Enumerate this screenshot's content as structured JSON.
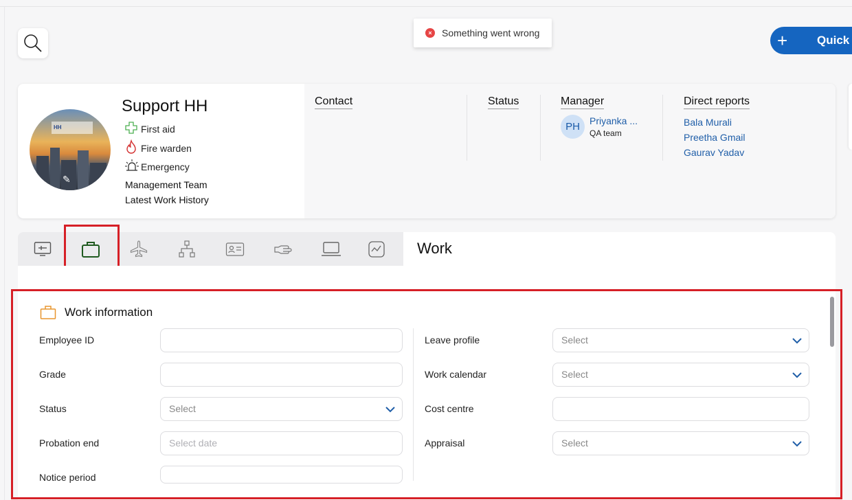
{
  "toast": {
    "message": "Something went wrong"
  },
  "quick_button": {
    "label": "Quick"
  },
  "profile": {
    "name": "Support HH",
    "badges": [
      {
        "label": "First aid",
        "icon": "first-aid-cross-icon"
      },
      {
        "label": "Fire warden",
        "icon": "flame-icon"
      },
      {
        "label": "Emergency",
        "icon": "siren-icon"
      }
    ],
    "links": [
      "Management Team",
      "Latest Work History"
    ],
    "columns": {
      "contact": "Contact",
      "status": "Status",
      "manager": "Manager",
      "direct_reports": "Direct reports"
    },
    "manager": {
      "initials": "PH",
      "name": "Priyanka ...",
      "team": "QA team"
    },
    "direct_reports": [
      "Bala Murali",
      "Preetha Gmail",
      "Gaurav Yadav"
    ]
  },
  "tabs": [
    {
      "name": "tab-dashboard",
      "icon": "monitor-icon"
    },
    {
      "name": "tab-work",
      "icon": "briefcase-icon",
      "selected": true
    },
    {
      "name": "tab-travel",
      "icon": "airplane-icon"
    },
    {
      "name": "tab-org-chart",
      "icon": "org-chart-icon"
    },
    {
      "name": "tab-id-card",
      "icon": "id-card-icon"
    },
    {
      "name": "tab-benefits",
      "icon": "hand-icon"
    },
    {
      "name": "tab-devices",
      "icon": "laptop-icon"
    },
    {
      "name": "tab-performance",
      "icon": "chart-icon"
    }
  ],
  "content": {
    "title": "Work",
    "section_title": "Work information",
    "left_fields": [
      {
        "label": "Employee ID",
        "value": "",
        "type": "text"
      },
      {
        "label": "Grade",
        "value": "",
        "type": "text"
      },
      {
        "label": "Status",
        "value": "Select",
        "type": "select"
      },
      {
        "label": "Probation end",
        "value": "Select date",
        "type": "date"
      },
      {
        "label": "Notice period",
        "value": "",
        "type": "text"
      }
    ],
    "right_fields": [
      {
        "label": "Leave profile",
        "value": "Select",
        "type": "select"
      },
      {
        "label": "Work calendar",
        "value": "Select",
        "type": "select"
      },
      {
        "label": "Cost centre",
        "value": "",
        "type": "text"
      },
      {
        "label": "Appraisal",
        "value": "Select",
        "type": "select"
      }
    ]
  },
  "colors": {
    "accent": "#1565c0",
    "highlight": "#d61f26",
    "link": "#1f5ea8",
    "section_icon": "#e8952e"
  }
}
